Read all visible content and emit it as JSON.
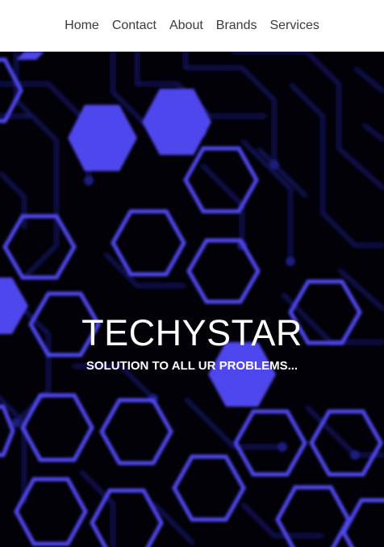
{
  "nav": {
    "items": [
      {
        "label": "Home"
      },
      {
        "label": "Contact"
      },
      {
        "label": "About"
      },
      {
        "label": "Brands"
      },
      {
        "label": "Services"
      }
    ]
  },
  "hero": {
    "title": "TECHYSTAR",
    "subtitle": "SOLUTION TO ALL UR PROBLEMS...",
    "background_colors": {
      "base": "#020108",
      "circuit": "#1a1670",
      "hexagon": "#4f47ee"
    }
  }
}
